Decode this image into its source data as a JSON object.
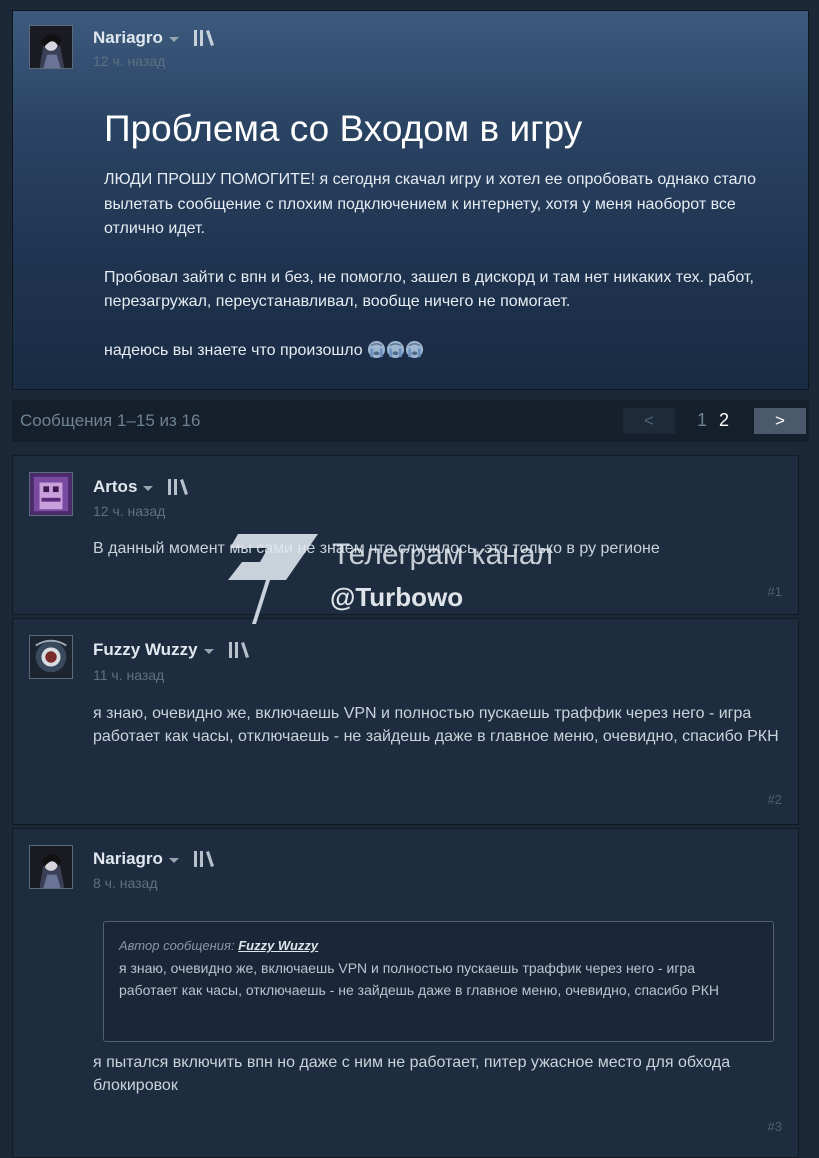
{
  "topic": {
    "author": "Nariagro",
    "time": "12 ч. назад",
    "title": "Проблема со Входом в игру",
    "paragraphs": [
      "ЛЮДИ ПРОШУ ПОМОГИТЕ! я сегодня скачал игру и хотел ее опробовать однако стало вылетать сообщение с плохим подключением к интернету, хотя у меня наоборот все отлично идет.",
      "Пробовал зайти с впн и без, не помогло, зашел в дискорд и там нет никаких тех. работ, перезагружал, переустанавливал, вообще ничего не помогает.",
      "надеюсь вы знаете что произошло"
    ],
    "emoji": [
      "crying-face-icon",
      "crying-face-icon",
      "crying-face-icon"
    ]
  },
  "pagination": {
    "summary": "Сообщения 1–15 из 16",
    "prev": "<",
    "pages": [
      "1",
      "2"
    ],
    "current": "2",
    "next": ">"
  },
  "comments": [
    {
      "author": "Artos",
      "time": "12 ч. назад",
      "text": "В данный момент мы сами не знаем что случилось, это только в ру регионе",
      "number": "#1"
    },
    {
      "author": "Fuzzy Wuzzy",
      "time": "11 ч. назад",
      "text": "я знаю, очевидно же, включаешь VPN и полностью пускаешь траффик через него - игра работает как часы, отключаешь - не зайдешь даже в главное меню, очевидно, спасибо РКН",
      "number": "#2"
    },
    {
      "author": "Nariagro",
      "time": "8 ч. назад",
      "quote_prefix": "Автор сообщения:",
      "quote_author": "Fuzzy Wuzzy",
      "quote_text": "я знаю, очевидно же, включаешь VPN и полностью пускаешь траффик через него - игра работает как часы, отключаешь - не зайдешь даже в главное меню, очевидно, спасибо РКН",
      "text": "я пытался включить впн но даже с ним не работает, питер ужасное место для обхода блокировок",
      "number": "#3"
    }
  ],
  "watermark": {
    "line1": "Телеграм канал",
    "line2": "@Turbowo"
  },
  "colors": {
    "background": "#1b2838",
    "link": "#dde4ea",
    "muted": "#5e7183"
  }
}
